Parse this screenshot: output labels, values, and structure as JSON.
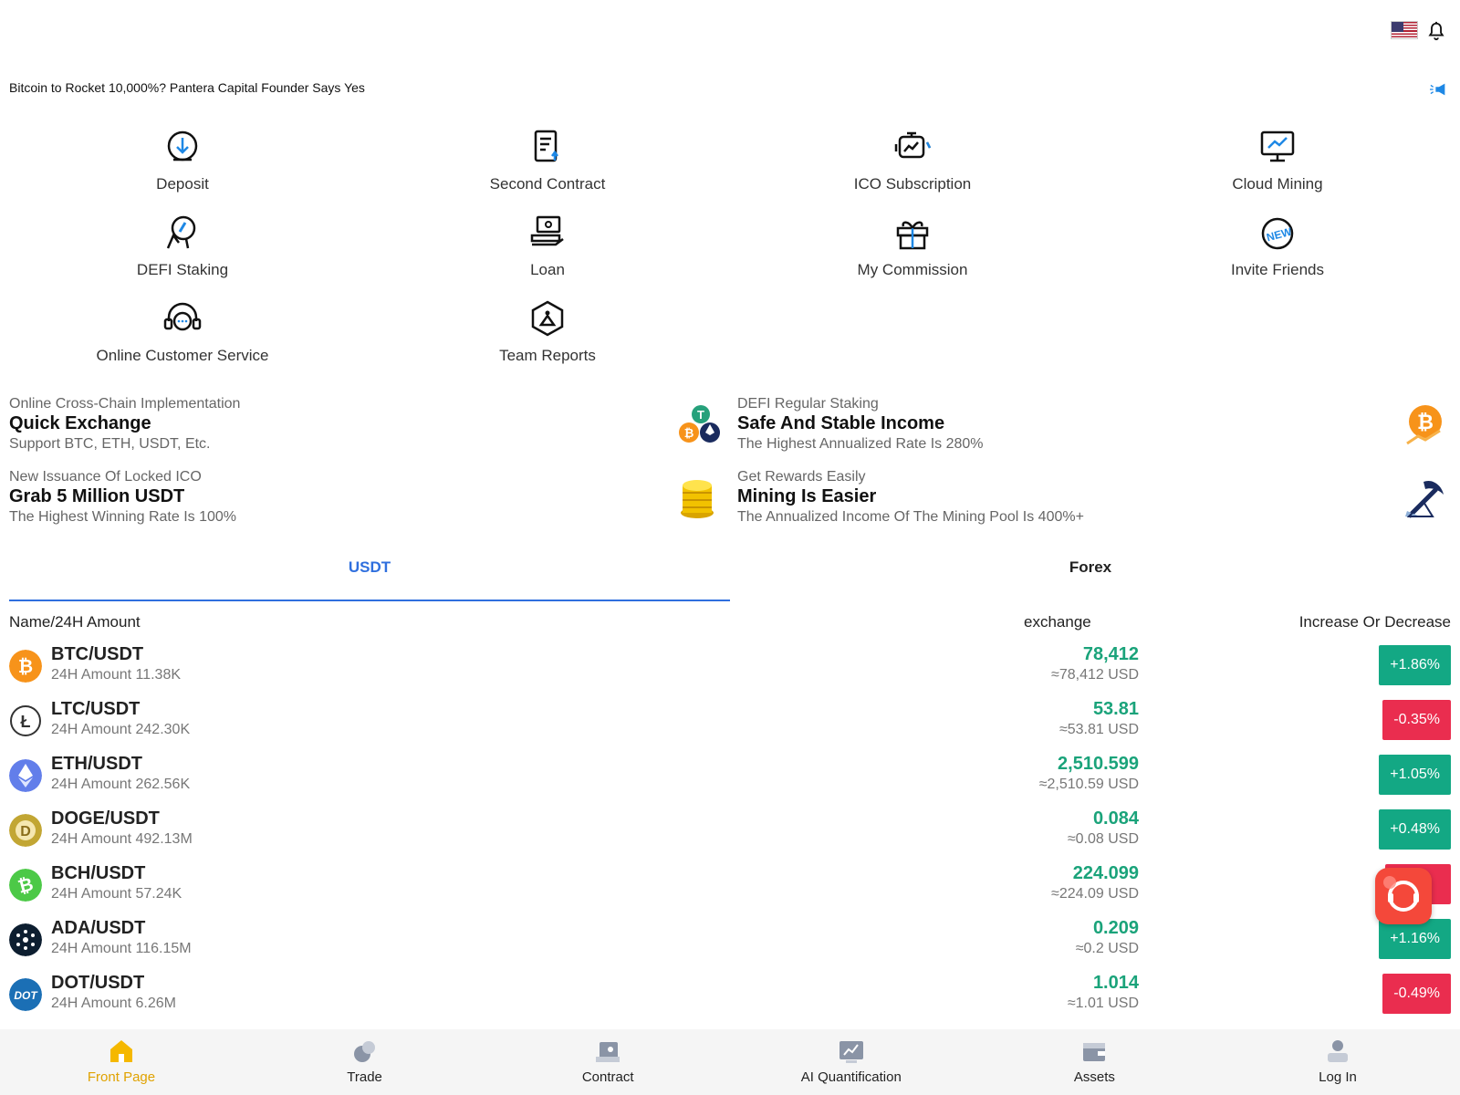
{
  "header": {
    "flag_icon": "us-flag-icon",
    "bell_icon": "bell-icon"
  },
  "news": {
    "headline": "Bitcoin to Rocket 10,000%? Pantera Capital Founder Says Yes",
    "icon": "megaphone-icon"
  },
  "menu": [
    {
      "label": "Deposit",
      "icon": "download-circle-icon"
    },
    {
      "label": "Second Contract",
      "icon": "document-icon"
    },
    {
      "label": "ICO Subscription",
      "icon": "ico-icon"
    },
    {
      "label": "Cloud Mining",
      "icon": "monitor-chart-icon"
    },
    {
      "label": "DEFI Staking",
      "icon": "hand-gem-icon"
    },
    {
      "label": "Loan",
      "icon": "loan-icon"
    },
    {
      "label": "My Commission",
      "icon": "gift-icon"
    },
    {
      "label": "Invite Friends",
      "icon": "new-badge-icon"
    },
    {
      "label": "Online Customer Service",
      "icon": "headset-icon"
    },
    {
      "label": "Team Reports",
      "icon": "hexagon-person-icon"
    }
  ],
  "promos": [
    {
      "sub": "Online Cross-Chain Implementation",
      "title": "Quick Exchange",
      "desc": "Support BTC, ETH, USDT, Etc.",
      "icon": "coins-cluster-icon"
    },
    {
      "sub": "DEFI Regular Staking",
      "title": "Safe And Stable Income",
      "desc": "The Highest Annualized Rate Is 280%",
      "icon": "bitcoin-growth-icon"
    },
    {
      "sub": "New Issuance Of Locked ICO",
      "title": "Grab 5 Million USDT",
      "desc": "The Highest Winning Rate Is 100%",
      "icon": "gold-coins-icon"
    },
    {
      "sub": "Get Rewards Easily",
      "title": "Mining Is Easier",
      "desc": "The Annualized Income Of The Mining Pool Is 400%+",
      "icon": "pickaxe-icon"
    }
  ],
  "tabs": [
    {
      "label": "USDT",
      "active": true
    },
    {
      "label": "Forex",
      "active": false
    }
  ],
  "columns": {
    "name": "Name/24H Amount",
    "exchange": "exchange",
    "change": "Increase Or Decrease"
  },
  "market": [
    {
      "pair": "BTC/USDT",
      "amount": "24H Amount 11.38K",
      "price": "78,412",
      "usd": "≈78,412 USD",
      "change": "+1.86%",
      "dir": "up",
      "color": "#f7931a",
      "icon": "btc-icon"
    },
    {
      "pair": "LTC/USDT",
      "amount": "24H Amount 242.30K",
      "price": "53.81",
      "usd": "≈53.81 USD",
      "change": "-0.35%",
      "dir": "down",
      "color": "#ffffff",
      "icon": "ltc-icon"
    },
    {
      "pair": "ETH/USDT",
      "amount": "24H Amount 262.56K",
      "price": "2,510.599",
      "usd": "≈2,510.59 USD",
      "change": "+1.05%",
      "dir": "up",
      "color": "#627eea",
      "icon": "eth-icon"
    },
    {
      "pair": "DOGE/USDT",
      "amount": "24H Amount 492.13M",
      "price": "0.084",
      "usd": "≈0.08 USD",
      "change": "+0.48%",
      "dir": "up",
      "color": "#c2a633",
      "icon": "doge-icon"
    },
    {
      "pair": "BCH/USDT",
      "amount": "24H Amount 57.24K",
      "price": "224.099",
      "usd": "≈224.09 USD",
      "change": "%",
      "dir": "down",
      "color": "#4cc947",
      "icon": "bch-icon"
    },
    {
      "pair": "ADA/USDT",
      "amount": "24H Amount 116.15M",
      "price": "0.209",
      "usd": "≈0.2 USD",
      "change": "+1.16%",
      "dir": "up",
      "color": "#0d1e30",
      "icon": "ada-icon"
    },
    {
      "pair": "DOT/USDT",
      "amount": "24H Amount 6.26M",
      "price": "1.014",
      "usd": "≈1.01 USD",
      "change": "-0.49%",
      "dir": "down",
      "color": "#1b6fb5",
      "icon": "dot-icon"
    }
  ],
  "bottom_nav": [
    {
      "label": "Front Page",
      "icon": "home-icon",
      "active": true
    },
    {
      "label": "Trade",
      "icon": "trade-icon",
      "active": false
    },
    {
      "label": "Contract",
      "icon": "contract-icon",
      "active": false
    },
    {
      "label": "AI Quantification",
      "icon": "ai-chart-icon",
      "active": false
    },
    {
      "label": "Assets",
      "icon": "wallet-icon",
      "active": false
    },
    {
      "label": "Log In",
      "icon": "user-icon",
      "active": false
    }
  ],
  "colors": {
    "accent": "#2f6fde",
    "up": "#13a884",
    "down": "#ea2d4f",
    "price": "#1aa37a",
    "nav_active": "#e0a200"
  }
}
